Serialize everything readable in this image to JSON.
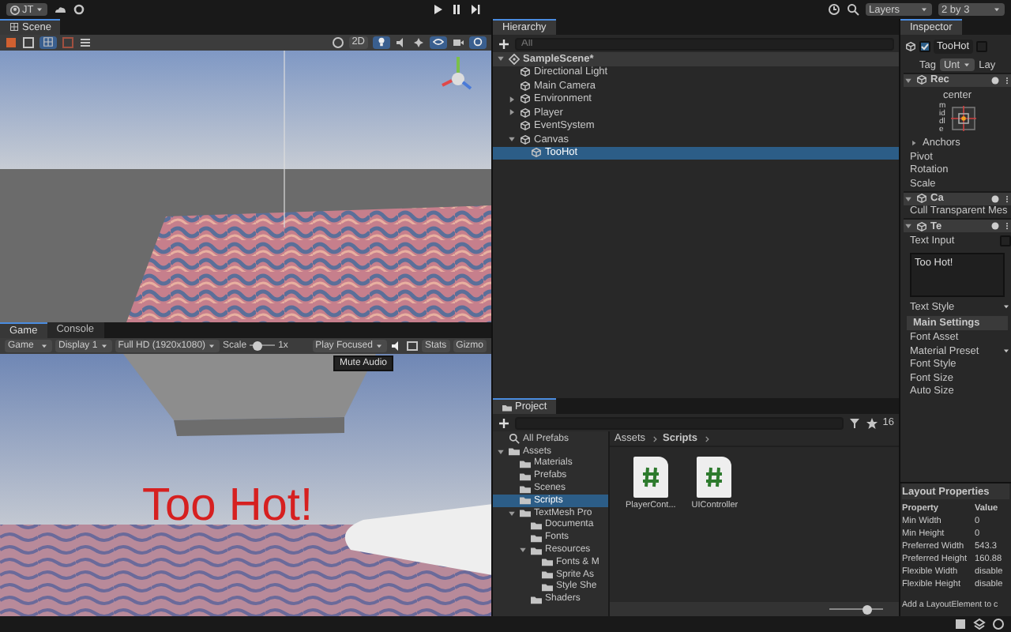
{
  "toolbar": {
    "account": "JT",
    "layers": "Layers",
    "layout": "2 by 3"
  },
  "scene": {
    "tab": "Scene",
    "mode_2d": "2D"
  },
  "game": {
    "tabs": [
      {
        "label": "Game",
        "selected": true
      },
      {
        "label": "Console",
        "selected": false
      }
    ],
    "view": "Game",
    "display": "Display 1",
    "resolution": "Full HD (1920x1080)",
    "scale_label": "Scale",
    "scale": {
      "level": 0.3
    },
    "scale_value": "1x",
    "play_mode": "Play Focused",
    "stats": "Stats",
    "gizmos": "Gizmo",
    "tooltip": "Mute Audio",
    "overlay_text": "Too Hot!"
  },
  "hierarchy": {
    "tab": "Hierarchy",
    "search": {
      "placeholder": "All"
    },
    "items": [
      {
        "label": "SampleScene*",
        "kind": "scene",
        "expanded": true,
        "selected": false,
        "children": [
          {
            "label": "Directional Light",
            "kind": "object",
            "selected": false
          },
          {
            "label": "Main Camera",
            "kind": "object",
            "selected": false
          },
          {
            "label": "Environment",
            "kind": "object",
            "expanded": false,
            "selected": false
          },
          {
            "label": "Player",
            "kind": "object",
            "expanded": false,
            "selected": false
          },
          {
            "label": "EventSystem",
            "kind": "object",
            "selected": false
          },
          {
            "label": "Canvas",
            "kind": "object",
            "expanded": true,
            "selected": false,
            "children": [
              {
                "label": "TooHot",
                "kind": "object",
                "selected": true
              }
            ]
          }
        ]
      }
    ]
  },
  "project": {
    "tab": "Project",
    "count": "16",
    "breadcrumb": [
      "Assets",
      "Scripts"
    ],
    "zoom": {
      "level": 0.7
    },
    "tree": [
      {
        "label": "All Prefabs",
        "kind": "search",
        "selected": false
      },
      {
        "label": "Assets",
        "kind": "folder",
        "expanded": true,
        "selected": false,
        "children": [
          {
            "label": "Materials",
            "kind": "folder",
            "selected": false
          },
          {
            "label": "Prefabs",
            "kind": "folder",
            "selected": false
          },
          {
            "label": "Scenes",
            "kind": "folder",
            "selected": false
          },
          {
            "label": "Scripts",
            "kind": "folder",
            "selected": true
          },
          {
            "label": "TextMesh Pro",
            "kind": "folder",
            "expanded": true,
            "selected": false,
            "children": [
              {
                "label": "Documenta",
                "kind": "folder",
                "selected": false
              },
              {
                "label": "Fonts",
                "kind": "folder",
                "selected": false
              },
              {
                "label": "Resources",
                "kind": "folder",
                "expanded": true,
                "selected": false,
                "children": [
                  {
                    "label": "Fonts & M",
                    "kind": "folder",
                    "selected": false
                  },
                  {
                    "label": "Sprite As",
                    "kind": "folder",
                    "selected": false
                  },
                  {
                    "label": "Style She",
                    "kind": "folder",
                    "selected": false
                  }
                ]
              },
              {
                "label": "Shaders",
                "kind": "folder",
                "selected": false
              }
            ]
          }
        ]
      }
    ],
    "files": [
      {
        "name": "PlayerCont..."
      },
      {
        "name": "UIController"
      }
    ]
  },
  "inspector": {
    "tab": "Inspector",
    "object_name": "TooHot",
    "active": true,
    "static": false,
    "tag_label": "Tag",
    "tag": "Unt",
    "layer_label": "Lay",
    "rows": [
      {
        "kind": "header",
        "title": "Rec",
        "expanded": true
      },
      {
        "kind": "anchor",
        "top": "center",
        "side": "middle"
      },
      {
        "kind": "foldout",
        "label": "Anchors",
        "expanded": false
      },
      {
        "kind": "field",
        "label": "Pivot"
      },
      {
        "kind": "field",
        "label": "Rotation"
      },
      {
        "kind": "field",
        "label": "Scale"
      },
      {
        "kind": "header",
        "title": "Ca",
        "expanded": true
      },
      {
        "kind": "field",
        "label": "Cull Transparent Mes"
      },
      {
        "kind": "header",
        "title": "Te",
        "expanded": true
      },
      {
        "kind": "toggle",
        "label": "Text Input",
        "checked": false
      },
      {
        "kind": "textarea",
        "value": "Too Hot!"
      },
      {
        "kind": "dropdown",
        "label": "Text Style"
      },
      {
        "kind": "section",
        "label": "Main Settings"
      },
      {
        "kind": "field",
        "label": "Font Asset"
      },
      {
        "kind": "dropdown",
        "label": "Material Preset"
      },
      {
        "kind": "field",
        "label": "Font Style"
      },
      {
        "kind": "field",
        "label": "Font Size"
      },
      {
        "kind": "field",
        "label": "Auto Size"
      }
    ],
    "layout_title": "Layout Properties",
    "layout_columns": [
      "Property",
      "Value"
    ],
    "layout_rows": [
      [
        "Min Width",
        "0"
      ],
      [
        "Min Height",
        "0"
      ],
      [
        "Preferred Width",
        "543.3"
      ],
      [
        "Preferred Height",
        "160.88"
      ],
      [
        "Flexible Width",
        "disable"
      ],
      [
        "Flexible Height",
        "disable"
      ]
    ],
    "layout_hint": "Add a LayoutElement to c"
  }
}
